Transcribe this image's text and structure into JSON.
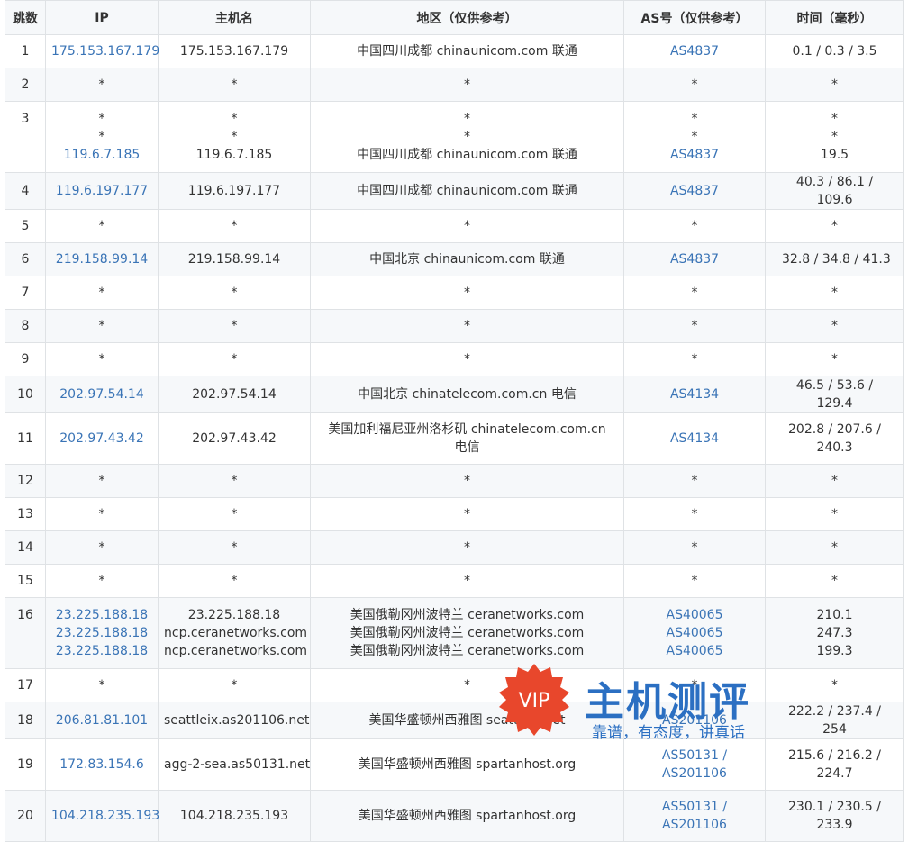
{
  "headers": [
    "跳数",
    "IP",
    "主机名",
    "地区（仅供参考）",
    "AS号（仅供参考）",
    "时间（毫秒）"
  ],
  "rows": [
    {
      "hop": "1",
      "ip": [
        "175.153.167.179"
      ],
      "host": [
        "175.153.167.179"
      ],
      "region": [
        "中国四川成都 chinaunicom.com 联通"
      ],
      "asn": [
        "AS4837"
      ],
      "time": [
        "0.1 / 0.3 / 3.5"
      ]
    },
    {
      "hop": "2",
      "ip": [
        "*"
      ],
      "host": [
        "*"
      ],
      "region": [
        "*"
      ],
      "asn": [
        "*"
      ],
      "time": [
        "*"
      ]
    },
    {
      "hop": "3",
      "ip": [
        "*",
        "*",
        "119.6.7.185"
      ],
      "host": [
        "*",
        "*",
        "119.6.7.185"
      ],
      "region": [
        "*",
        "*",
        "中国四川成都 chinaunicom.com 联通"
      ],
      "asn": [
        "*",
        "*",
        "AS4837"
      ],
      "time": [
        "*",
        "*",
        "19.5"
      ]
    },
    {
      "hop": "4",
      "ip": [
        "119.6.197.177"
      ],
      "host": [
        "119.6.197.177"
      ],
      "region": [
        "中国四川成都 chinaunicom.com 联通"
      ],
      "asn": [
        "AS4837"
      ],
      "time": [
        "40.3 / 86.1 / 109.6"
      ]
    },
    {
      "hop": "5",
      "ip": [
        "*"
      ],
      "host": [
        "*"
      ],
      "region": [
        "*"
      ],
      "asn": [
        "*"
      ],
      "time": [
        "*"
      ]
    },
    {
      "hop": "6",
      "ip": [
        "219.158.99.14"
      ],
      "host": [
        "219.158.99.14"
      ],
      "region": [
        "中国北京 chinaunicom.com 联通"
      ],
      "asn": [
        "AS4837"
      ],
      "time": [
        "32.8 / 34.8 / 41.3"
      ]
    },
    {
      "hop": "7",
      "ip": [
        "*"
      ],
      "host": [
        "*"
      ],
      "region": [
        "*"
      ],
      "asn": [
        "*"
      ],
      "time": [
        "*"
      ]
    },
    {
      "hop": "8",
      "ip": [
        "*"
      ],
      "host": [
        "*"
      ],
      "region": [
        "*"
      ],
      "asn": [
        "*"
      ],
      "time": [
        "*"
      ]
    },
    {
      "hop": "9",
      "ip": [
        "*"
      ],
      "host": [
        "*"
      ],
      "region": [
        "*"
      ],
      "asn": [
        "*"
      ],
      "time": [
        "*"
      ]
    },
    {
      "hop": "10",
      "ip": [
        "202.97.54.14"
      ],
      "host": [
        "202.97.54.14"
      ],
      "region": [
        "中国北京 chinatelecom.com.cn 电信"
      ],
      "asn": [
        "AS4134"
      ],
      "time": [
        "46.5 / 53.6 / 129.4"
      ]
    },
    {
      "hop": "11",
      "ip": [
        "202.97.43.42"
      ],
      "host": [
        "202.97.43.42"
      ],
      "region": [
        "美国加利福尼亚州洛杉矶 chinatelecom.com.cn 电信"
      ],
      "asn": [
        "AS4134"
      ],
      "time": [
        "202.8 / 207.6 / 240.3"
      ]
    },
    {
      "hop": "12",
      "ip": [
        "*"
      ],
      "host": [
        "*"
      ],
      "region": [
        "*"
      ],
      "asn": [
        "*"
      ],
      "time": [
        "*"
      ]
    },
    {
      "hop": "13",
      "ip": [
        "*"
      ],
      "host": [
        "*"
      ],
      "region": [
        "*"
      ],
      "asn": [
        "*"
      ],
      "time": [
        "*"
      ]
    },
    {
      "hop": "14",
      "ip": [
        "*"
      ],
      "host": [
        "*"
      ],
      "region": [
        "*"
      ],
      "asn": [
        "*"
      ],
      "time": [
        "*"
      ]
    },
    {
      "hop": "15",
      "ip": [
        "*"
      ],
      "host": [
        "*"
      ],
      "region": [
        "*"
      ],
      "asn": [
        "*"
      ],
      "time": [
        "*"
      ]
    },
    {
      "hop": "16",
      "ip": [
        "23.225.188.18",
        "23.225.188.18",
        "23.225.188.18"
      ],
      "host": [
        "23.225.188.18",
        "ncp.ceranetworks.com",
        "ncp.ceranetworks.com"
      ],
      "region": [
        "美国俄勒冈州波特兰 ceranetworks.com",
        "美国俄勒冈州波特兰 ceranetworks.com",
        "美国俄勒冈州波特兰 ceranetworks.com"
      ],
      "asn": [
        "AS40065",
        "AS40065",
        "AS40065"
      ],
      "time": [
        "210.1",
        "247.3",
        "199.3"
      ]
    },
    {
      "hop": "17",
      "ip": [
        "*"
      ],
      "host": [
        "*"
      ],
      "region": [
        "*"
      ],
      "asn": [
        "*"
      ],
      "time": [
        "*"
      ]
    },
    {
      "hop": "18",
      "ip": [
        "206.81.81.101"
      ],
      "host": [
        "seattleix.as201106.net"
      ],
      "region": [
        "美国华盛顿州西雅图 seattleix.net"
      ],
      "asn": [
        "AS201106"
      ],
      "time": [
        "222.2 / 237.4 / 254"
      ]
    },
    {
      "hop": "19",
      "ip": [
        "172.83.154.6"
      ],
      "host": [
        "agg-2-sea.as50131.net"
      ],
      "region": [
        "美国华盛顿州西雅图 spartanhost.org"
      ],
      "asn": [
        "AS50131 / AS201106"
      ],
      "time": [
        "215.6 / 216.2 / 224.7"
      ]
    },
    {
      "hop": "20",
      "ip": [
        "104.218.235.193"
      ],
      "host": [
        "104.218.235.193"
      ],
      "region": [
        "美国华盛顿州西雅图 spartanhost.org"
      ],
      "asn": [
        "AS50131 / AS201106"
      ],
      "time": [
        "230.1 / 230.5 / 233.9"
      ]
    }
  ],
  "watermark": {
    "badge": "VIP",
    "title": "主机测评",
    "subtitle": "靠谱，有态度，讲真话"
  },
  "colors": {
    "link": "#3a74b6",
    "header_bg": "#f6f8fa",
    "border": "#dfe2e5",
    "badge": "#e8472c",
    "watermark": "#2b6fc2"
  }
}
